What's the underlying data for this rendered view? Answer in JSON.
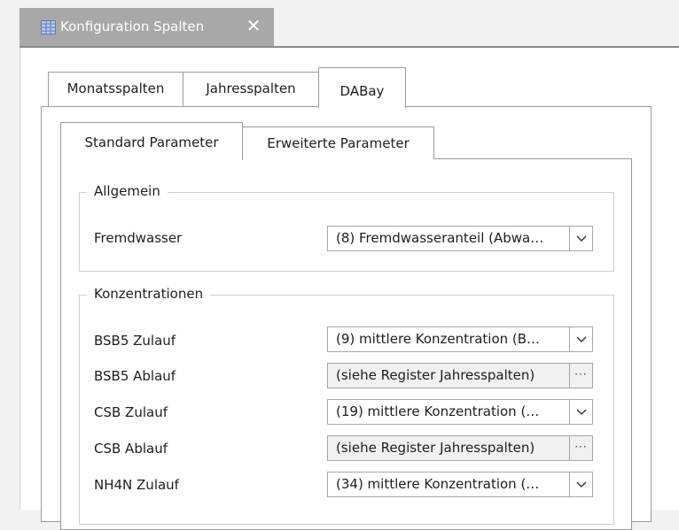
{
  "document_tab": {
    "title": "Konfiguration Spalten",
    "close_glyph": "✕",
    "icon": "grid-table-icon"
  },
  "outer_tabs": [
    {
      "label": "Monatsspalten",
      "active": false
    },
    {
      "label": "Jahresspalten",
      "active": false
    },
    {
      "label": "DABay",
      "active": true
    }
  ],
  "inner_tabs": [
    {
      "label": "Standard Parameter",
      "active": true
    },
    {
      "label": "Erweiterte Parameter",
      "active": false
    }
  ],
  "groups": {
    "allgemein": {
      "title": "Allgemein",
      "rows": [
        {
          "label": "Fremdwasser",
          "value": "(8) Fremdwasseranteil (Abwa…",
          "button": "dropdown",
          "readonly": false
        }
      ]
    },
    "konzentrationen": {
      "title": "Konzentrationen",
      "rows": [
        {
          "label": "BSB5 Zulauf",
          "value": "(9) mittlere Konzentration (B…",
          "button": "dropdown",
          "readonly": false
        },
        {
          "label": "BSB5 Ablauf",
          "value": "(siehe Register Jahresspalten)",
          "button": "ellipsis",
          "readonly": true
        },
        {
          "label": "CSB Zulauf",
          "value": "(19) mittlere Konzentration (…",
          "button": "dropdown",
          "readonly": false
        },
        {
          "label": "CSB Ablauf",
          "value": "(siehe Register Jahresspalten)",
          "button": "ellipsis",
          "readonly": true
        },
        {
          "label": "NH4N Zulauf",
          "value": "(34) mittlere Konzentration (…",
          "button": "dropdown",
          "readonly": false
        }
      ]
    }
  },
  "glyphs": {
    "ellipsis": "···"
  },
  "colors": {
    "doc_tab_bg": "#a8a8a8",
    "border": "#9a9a9a",
    "group_border": "#d0d0d0",
    "readonly_bg": "#f0f0f0"
  }
}
